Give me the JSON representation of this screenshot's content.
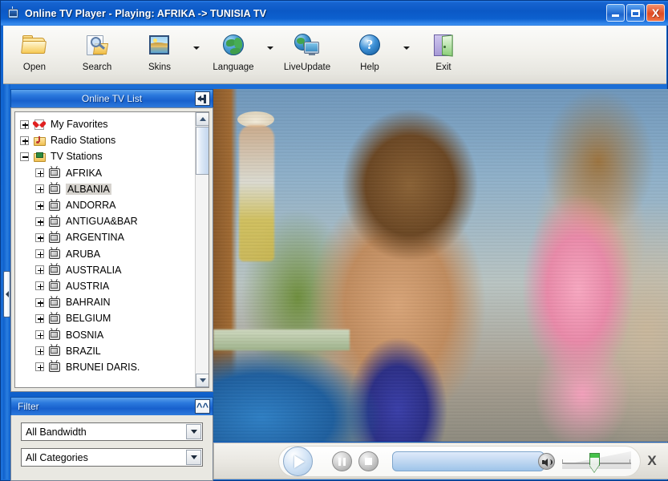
{
  "window": {
    "title": "Online TV Player - Playing: AFRIKA -> TUNISIA TV",
    "icon": "tv-icon",
    "buttons": {
      "minimize": "minimize-icon",
      "maximize": "maximize-icon",
      "close": "X"
    }
  },
  "toolbar": {
    "items": [
      {
        "label": "Open",
        "icon": "open-folder-icon",
        "dropdown": false
      },
      {
        "label": "Search",
        "icon": "search-folder-icon",
        "dropdown": false
      },
      {
        "label": "Skins",
        "icon": "picture-icon",
        "dropdown": true
      },
      {
        "label": "Language",
        "icon": "globe-icon",
        "dropdown": true
      },
      {
        "label": "LiveUpdate",
        "icon": "live-update-icon",
        "dropdown": false
      },
      {
        "label": "Help",
        "icon": "question-mark-icon",
        "dropdown": true
      },
      {
        "label": "Exit",
        "icon": "exit-door-icon",
        "dropdown": false
      }
    ]
  },
  "sidebar": {
    "panel_title": "Online TV List",
    "pin_button": "pin-icon",
    "tree": [
      {
        "label": "My Favorites",
        "level": 0,
        "expander": "plus",
        "icon": "favorites-icon",
        "selected": false
      },
      {
        "label": "Radio Stations",
        "level": 0,
        "expander": "plus",
        "icon": "radio-folder-icon",
        "selected": false
      },
      {
        "label": "TV Stations",
        "level": 0,
        "expander": "minus",
        "icon": "tv-folder-icon",
        "selected": false
      },
      {
        "label": "AFRIKA",
        "level": 1,
        "expander": "plus",
        "icon": "tv-station-icon",
        "selected": false
      },
      {
        "label": "ALBANIA",
        "level": 1,
        "expander": "plus",
        "icon": "tv-station-icon",
        "selected": true
      },
      {
        "label": "ANDORRA",
        "level": 1,
        "expander": "plus",
        "icon": "tv-station-icon",
        "selected": false
      },
      {
        "label": "ANTIGUA&BAR",
        "level": 1,
        "expander": "plus",
        "icon": "tv-station-icon",
        "selected": false
      },
      {
        "label": "ARGENTINA",
        "level": 1,
        "expander": "plus",
        "icon": "tv-station-icon",
        "selected": false
      },
      {
        "label": "ARUBA",
        "level": 1,
        "expander": "plus",
        "icon": "tv-station-icon",
        "selected": false
      },
      {
        "label": "AUSTRALIA",
        "level": 1,
        "expander": "plus",
        "icon": "tv-station-icon",
        "selected": false
      },
      {
        "label": "AUSTRIA",
        "level": 1,
        "expander": "plus",
        "icon": "tv-station-icon",
        "selected": false
      },
      {
        "label": "BAHRAIN",
        "level": 1,
        "expander": "plus",
        "icon": "tv-station-icon",
        "selected": false
      },
      {
        "label": "BELGIUM",
        "level": 1,
        "expander": "plus",
        "icon": "tv-station-icon",
        "selected": false
      },
      {
        "label": "BOSNIA",
        "level": 1,
        "expander": "plus",
        "icon": "tv-station-icon",
        "selected": false
      },
      {
        "label": "BRAZIL",
        "level": 1,
        "expander": "plus",
        "icon": "tv-station-icon",
        "selected": false
      },
      {
        "label": "BRUNEI DARIS.",
        "level": 1,
        "expander": "plus",
        "icon": "tv-station-icon",
        "selected": false
      }
    ],
    "scrollbar": {
      "up": "scroll-up-icon",
      "down": "scroll-down-icon"
    }
  },
  "filter": {
    "panel_title": "Filter",
    "collapse_button": "chevron-up-icon",
    "bandwidth": {
      "value": "All Bandwidth",
      "arrow": "chevron-down-icon"
    },
    "categories": {
      "value": "All Categories",
      "arrow": "chevron-down-icon"
    }
  },
  "splitter": {
    "handle": "collapse-left-icon"
  },
  "player": {
    "play": "play-icon",
    "pause": "pause-icon",
    "stop": "stop-icon",
    "progress_value": 0,
    "speaker": "speaker-icon",
    "volume_value": 45,
    "close": "X"
  },
  "colors": {
    "titlebar_blue": "#0b59c6",
    "panel_header_blue": "#1860cd",
    "accent_green": "#46c24a",
    "close_red": "#e04a22",
    "selection_gray": "#d6d3ce"
  }
}
